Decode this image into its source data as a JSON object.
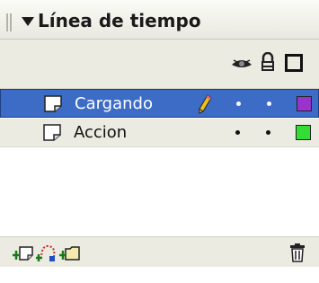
{
  "panel": {
    "title": "Línea de tiempo",
    "collapse_icon": "triangle-down-icon",
    "gripper_icon": "gripper-icon"
  },
  "header": {
    "columns": [
      {
        "name": "show-hide",
        "icon": "eye-icon"
      },
      {
        "name": "lock",
        "icon": "lock-icon"
      },
      {
        "name": "outline",
        "icon": "outline-square-icon"
      }
    ]
  },
  "layers": [
    {
      "name": "Cargando",
      "selected": true,
      "editing_icon": "pencil-icon",
      "visible_dot": "•",
      "lock_dot": "•",
      "color": "#9933cc"
    },
    {
      "name": "Accion",
      "selected": false,
      "editing_icon": "",
      "visible_dot": "•",
      "lock_dot": "•",
      "color": "#33dd33"
    }
  ],
  "toolbar": {
    "buttons": [
      {
        "name": "insert-layer",
        "icon": "insert-layer-icon"
      },
      {
        "name": "add-motion-guide",
        "icon": "add-motion-guide-icon"
      },
      {
        "name": "insert-layer-folder",
        "icon": "insert-folder-icon"
      },
      {
        "name": "delete-layer",
        "icon": "trash-icon"
      }
    ]
  },
  "colors": {
    "selection": "#3d6cc7",
    "panel_bg": "#ecebe1",
    "layer1_swatch": "#9933cc",
    "layer2_swatch": "#33dd33"
  }
}
